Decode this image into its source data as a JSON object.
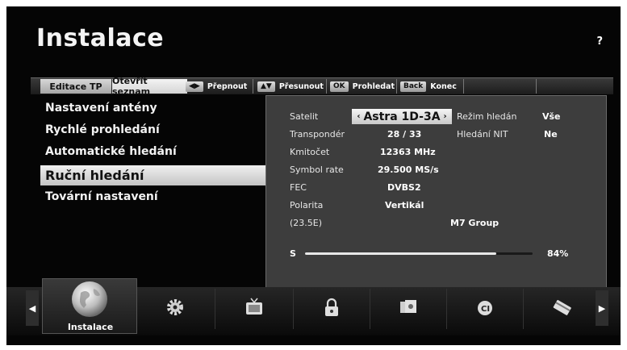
{
  "title": "Instalace",
  "help": "?",
  "tabs": {
    "edit": "Editace TP",
    "open_list": "Otevřít seznam"
  },
  "hints": [
    {
      "key": "◀▶",
      "label": "Přepnout"
    },
    {
      "key": "▲▼",
      "label": "Přesunout"
    },
    {
      "key": "OK",
      "label": "Prohledat"
    },
    {
      "key": "Back",
      "label": "Konec"
    }
  ],
  "menu": [
    "Nastavení antény",
    "Rychlé prohledání",
    "Automatické hledání",
    "Ruční hledání",
    "Tovární nastavení"
  ],
  "panel": {
    "satellite": {
      "label": "Satelit",
      "value": "Astra 1D-3A",
      "left": "‹",
      "right": "›"
    },
    "search_mode": {
      "label": "Režim hledán",
      "value": "Vše"
    },
    "transponder": {
      "label": "Transpondér",
      "value": "28 / 33"
    },
    "nit": {
      "label": "Hledání NIT",
      "value": "Ne"
    },
    "frequency": {
      "label": "Kmitočet",
      "value": "12363 MHz"
    },
    "symbol_rate": {
      "label": "Symbol rate",
      "value": "29.500 MS/s"
    },
    "fec": {
      "label": "FEC",
      "value": "DVBS2"
    },
    "polarity": {
      "label": "Polarita",
      "value": "Vertikál"
    },
    "position": "(23.5E)",
    "provider": "M7 Group",
    "signal": {
      "label": "S",
      "value": "84%",
      "fraction": 0.84
    }
  },
  "dock": {
    "active_label": "Instalace",
    "icons": [
      "globe-icon",
      "gear-icon",
      "tv-icon",
      "lock-icon",
      "media-icon",
      "ci-card-icon",
      "card-icon"
    ]
  }
}
